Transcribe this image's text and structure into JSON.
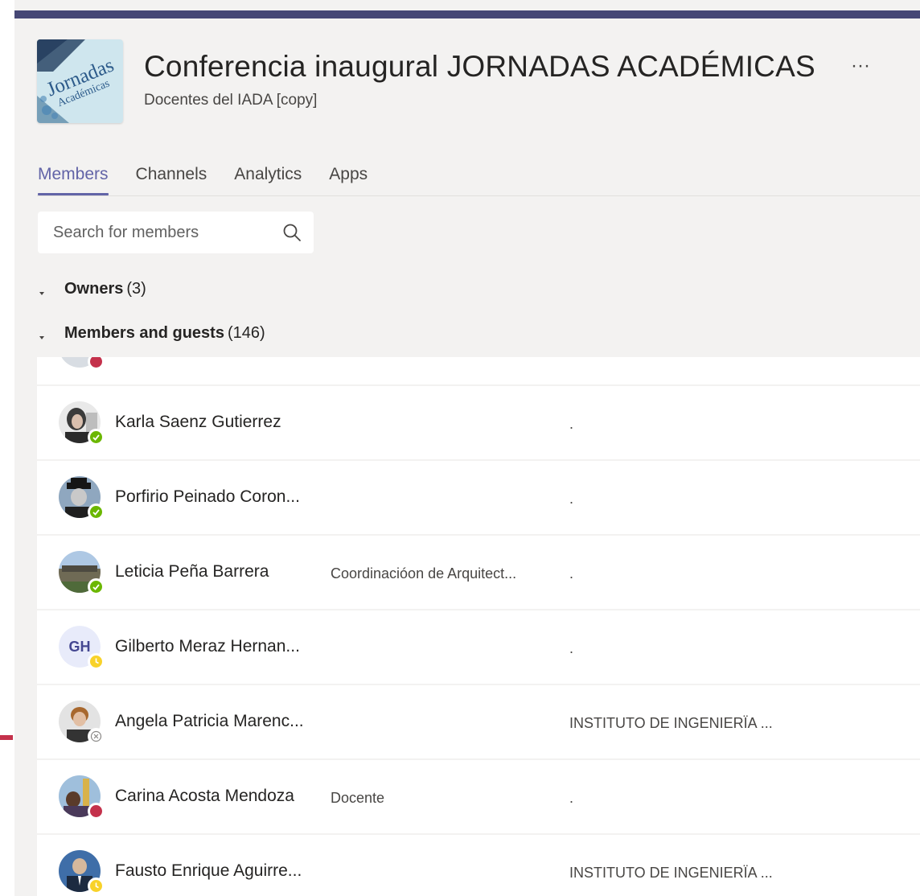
{
  "team": {
    "name": "Conferencia inaugural JORNADAS ACADÉMICAS",
    "more": "···",
    "subtitle": "Docentes del IADA [copy]",
    "logo_text_1": "Jornadas",
    "logo_text_2": "Académicas"
  },
  "tabs": [
    {
      "label": "Members",
      "active": true
    },
    {
      "label": "Channels",
      "active": false
    },
    {
      "label": "Analytics",
      "active": false
    },
    {
      "label": "Apps",
      "active": false
    }
  ],
  "search": {
    "placeholder": "Search for members"
  },
  "groups": {
    "owners": {
      "name": "Owners",
      "count": "(3)"
    },
    "members": {
      "name": "Members and guests",
      "count": "(146)"
    }
  },
  "members": [
    {
      "name": "Karla Saenz Gutierrez",
      "title": "",
      "location": ".",
      "presence": "available",
      "avatar": "photo"
    },
    {
      "name": "Porfirio Peinado Coron...",
      "title": "",
      "location": ".",
      "presence": "available",
      "avatar": "photo"
    },
    {
      "name": "Leticia Peña Barrera",
      "title": "Coordinacióon de Arquitect...",
      "location": ".",
      "presence": "available",
      "avatar": "photo"
    },
    {
      "name": "Gilberto Meraz Hernan...",
      "title": "",
      "location": ".",
      "presence": "away",
      "avatar": "initials",
      "initials": "GH"
    },
    {
      "name": "Angela Patricia Marenc...",
      "title": "",
      "location": "INSTITUTO DE INGENIERÏA ...",
      "presence": "offline",
      "avatar": "photo"
    },
    {
      "name": "Carina Acosta Mendoza",
      "title": "Docente",
      "location": ".",
      "presence": "busy",
      "avatar": "photo"
    },
    {
      "name": "Fausto Enrique Aguirre...",
      "title": "",
      "location": "INSTITUTO DE INGENIERÏA ...",
      "presence": "away",
      "avatar": "photo"
    }
  ],
  "colors": {
    "accent": "#6264a7",
    "header_bar": "#464775",
    "available": "#6bb700",
    "busy": "#c4314b",
    "away": "#f8d22a"
  }
}
